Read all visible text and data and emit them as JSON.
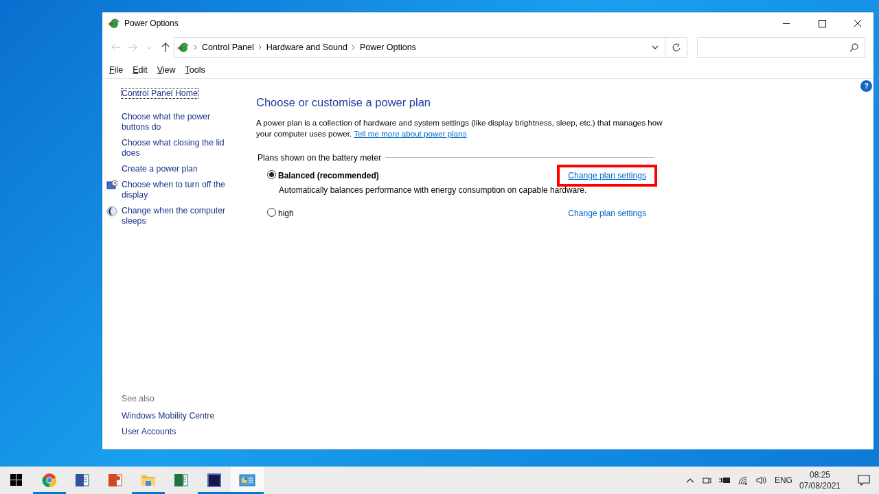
{
  "window": {
    "title": "Power Options",
    "breadcrumb": [
      "Control Panel",
      "Hardware and Sound",
      "Power Options"
    ],
    "menu": [
      "File",
      "Edit",
      "View",
      "Tools"
    ],
    "help": "?"
  },
  "sidebar": {
    "home": "Control Panel Home",
    "items": [
      {
        "label": "Choose what the power buttons do",
        "kind": "plain"
      },
      {
        "label": "Choose what closing the lid does",
        "kind": "plain"
      },
      {
        "label": "Create a power plan",
        "kind": "plain"
      },
      {
        "label": "Choose when to turn off the display",
        "kind": "display"
      },
      {
        "label": "Change when the computer sleeps",
        "kind": "sleep"
      }
    ],
    "see_also": {
      "title": "See also",
      "links": [
        "Windows Mobility Centre",
        "User Accounts"
      ]
    }
  },
  "main": {
    "title": "Choose or customise a power plan",
    "description": "A power plan is a collection of hardware and system settings (like display brightness, sleep, etc.) that manages how your computer uses power.",
    "more_link": "Tell me more about power plans",
    "group_label": "Plans shown on the battery meter",
    "plans": [
      {
        "name": "Balanced (recommended)",
        "selected": true,
        "description": "Automatically balances performance with energy consumption on capable hardware.",
        "action": "Change plan settings",
        "highlighted": true
      },
      {
        "name": "high",
        "selected": false,
        "action": "Change plan settings",
        "highlighted": false
      }
    ]
  },
  "taskbar": {
    "apps": [
      {
        "kind": "start",
        "running": false,
        "active": false
      },
      {
        "kind": "browser",
        "running": true,
        "active": false
      },
      {
        "kind": "document",
        "running": false,
        "active": false
      },
      {
        "kind": "slides",
        "running": false,
        "active": false
      },
      {
        "kind": "folder",
        "running": true,
        "active": false
      },
      {
        "kind": "spreadsheet",
        "running": false,
        "active": false
      },
      {
        "kind": "image-editor",
        "running": true,
        "active": false
      },
      {
        "kind": "control-panel",
        "running": true,
        "active": true
      }
    ],
    "language": "ENG",
    "time": "08:25",
    "date": "07/08/2021"
  }
}
